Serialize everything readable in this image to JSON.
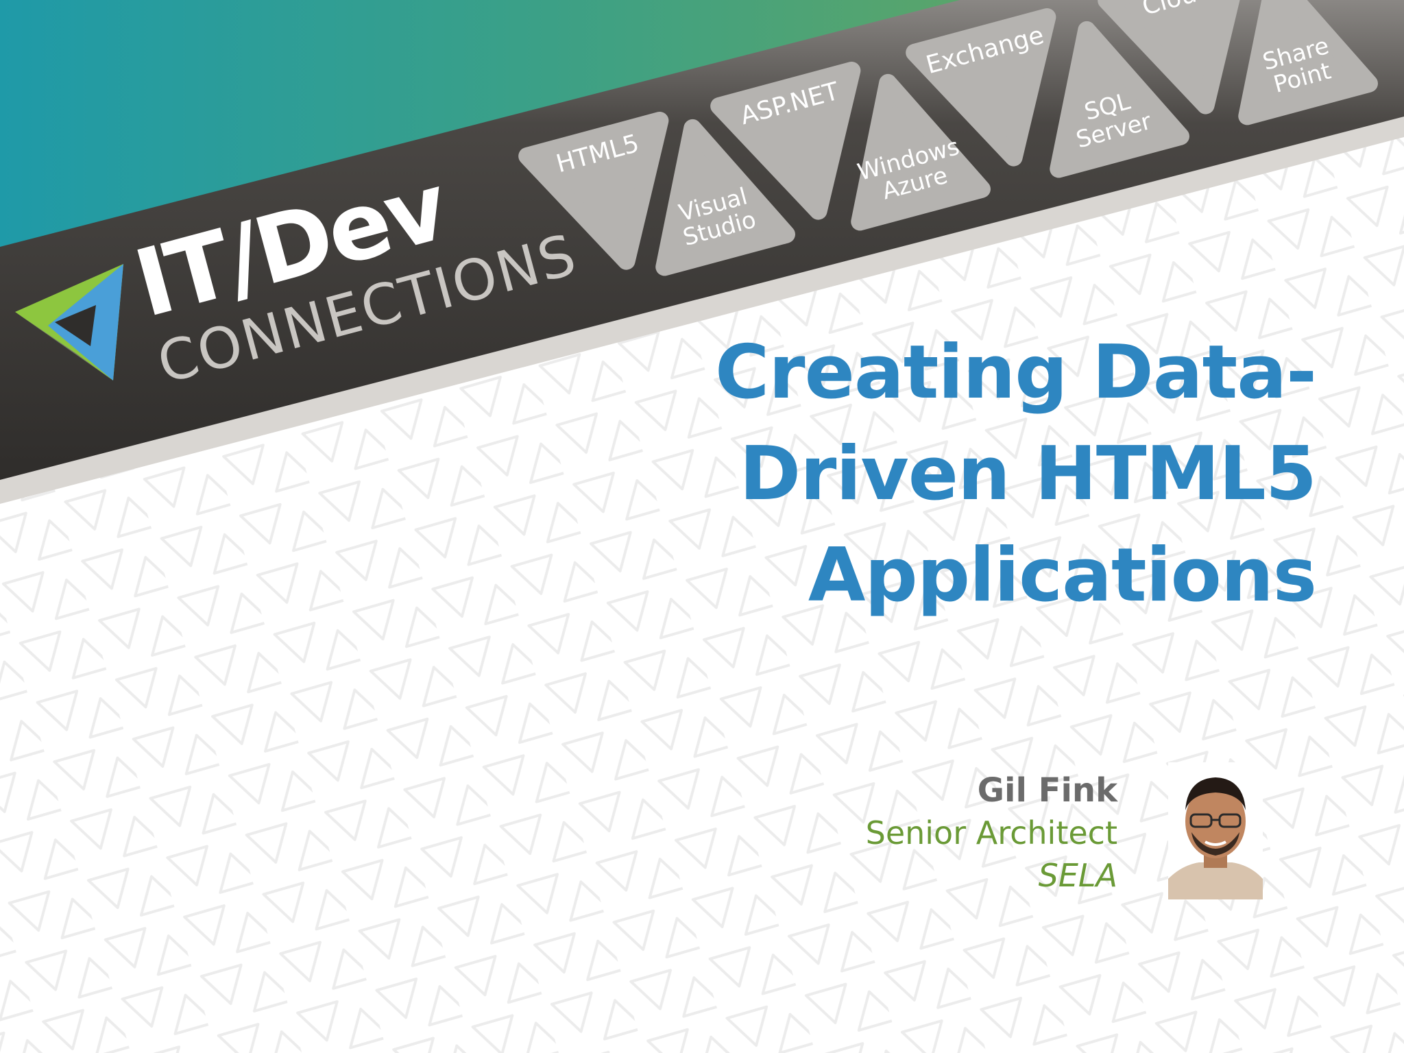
{
  "slide": {
    "title_lines": [
      "Creating Data-",
      "Driven HTML5",
      "Applications"
    ]
  },
  "brand": {
    "logo_main": "IT/Dev",
    "logo_sub": "CONNECTIONS"
  },
  "tech_tabs": [
    {
      "lines": [
        "HTML5"
      ]
    },
    {
      "lines": [
        "Visual",
        "Studio"
      ]
    },
    {
      "lines": [
        "ASP.NET"
      ]
    },
    {
      "lines": [
        "Windows",
        "Azure"
      ]
    },
    {
      "lines": [
        "Exchange"
      ]
    },
    {
      "lines": [
        "SQL",
        "Server"
      ]
    },
    {
      "lines": [
        "Cloud"
      ]
    },
    {
      "lines": [
        "Share",
        "Point"
      ]
    }
  ],
  "presenter": {
    "name": "Gil Fink",
    "role": "Senior Architect",
    "company": "SELA"
  },
  "colors": {
    "title": "#2E86C1",
    "banner_dark": "#3a3836",
    "banner_teal": "#1fa0a6",
    "banner_green": "#4fa070",
    "tab_gray": "#b5b3b0",
    "name_gray": "#6b6b6b",
    "role_green": "#6a9a36"
  }
}
